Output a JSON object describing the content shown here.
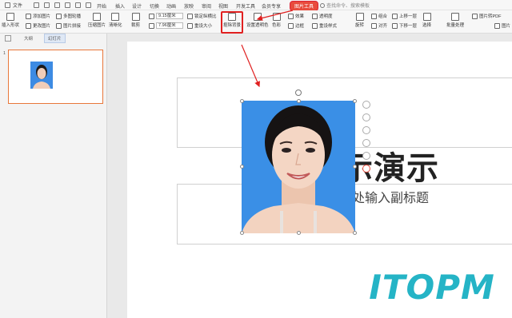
{
  "menubar": {
    "file_label": "文件",
    "tabs": [
      "开始",
      "插入",
      "设计",
      "切换",
      "动画",
      "放映",
      "审阅",
      "视图",
      "开发工具",
      "会员专享"
    ],
    "active_tab": "图片工具",
    "search_placeholder": "查找命令、搜索模板"
  },
  "ribbon": {
    "insert_shape": "插入形状",
    "add_image": "添加图片",
    "change_image": "更改图片",
    "multi_image": "多图轮播",
    "image_split": "图片拼接",
    "compress": "压缩图片",
    "clarity": "清晰化",
    "crop": "裁剪",
    "width_value": "9.15厘米",
    "height_value": "7.96厘米",
    "lock_ratio": "锁定纵横比",
    "reset_size": "重设大小",
    "remove_bg": "抠除背景",
    "set_transparent": "设置透明色",
    "color": "色彩",
    "effect": "效果",
    "transparency": "透明度",
    "border": "边框",
    "reset_style": "重设样式",
    "combine": "组合",
    "bring_forward": "上移一层",
    "send_backward": "下移一层",
    "rotate": "旋转",
    "align": "对齐",
    "select": "选择",
    "batch": "批量处理",
    "to_pdf": "图片转PDF",
    "more_image": "图片"
  },
  "leftpanel": {
    "tab_outline": "大纲",
    "tab_slides": "幻灯片",
    "slide_number": "1"
  },
  "slide": {
    "title_visible": "示演示",
    "subtitle_visible": "处输入副标题"
  },
  "watermark": {
    "text": "ITOPM"
  },
  "colors": {
    "accent_red": "#e84c3d",
    "photo_bg": "#3a8fe6",
    "watermark": "#25b4c6"
  }
}
